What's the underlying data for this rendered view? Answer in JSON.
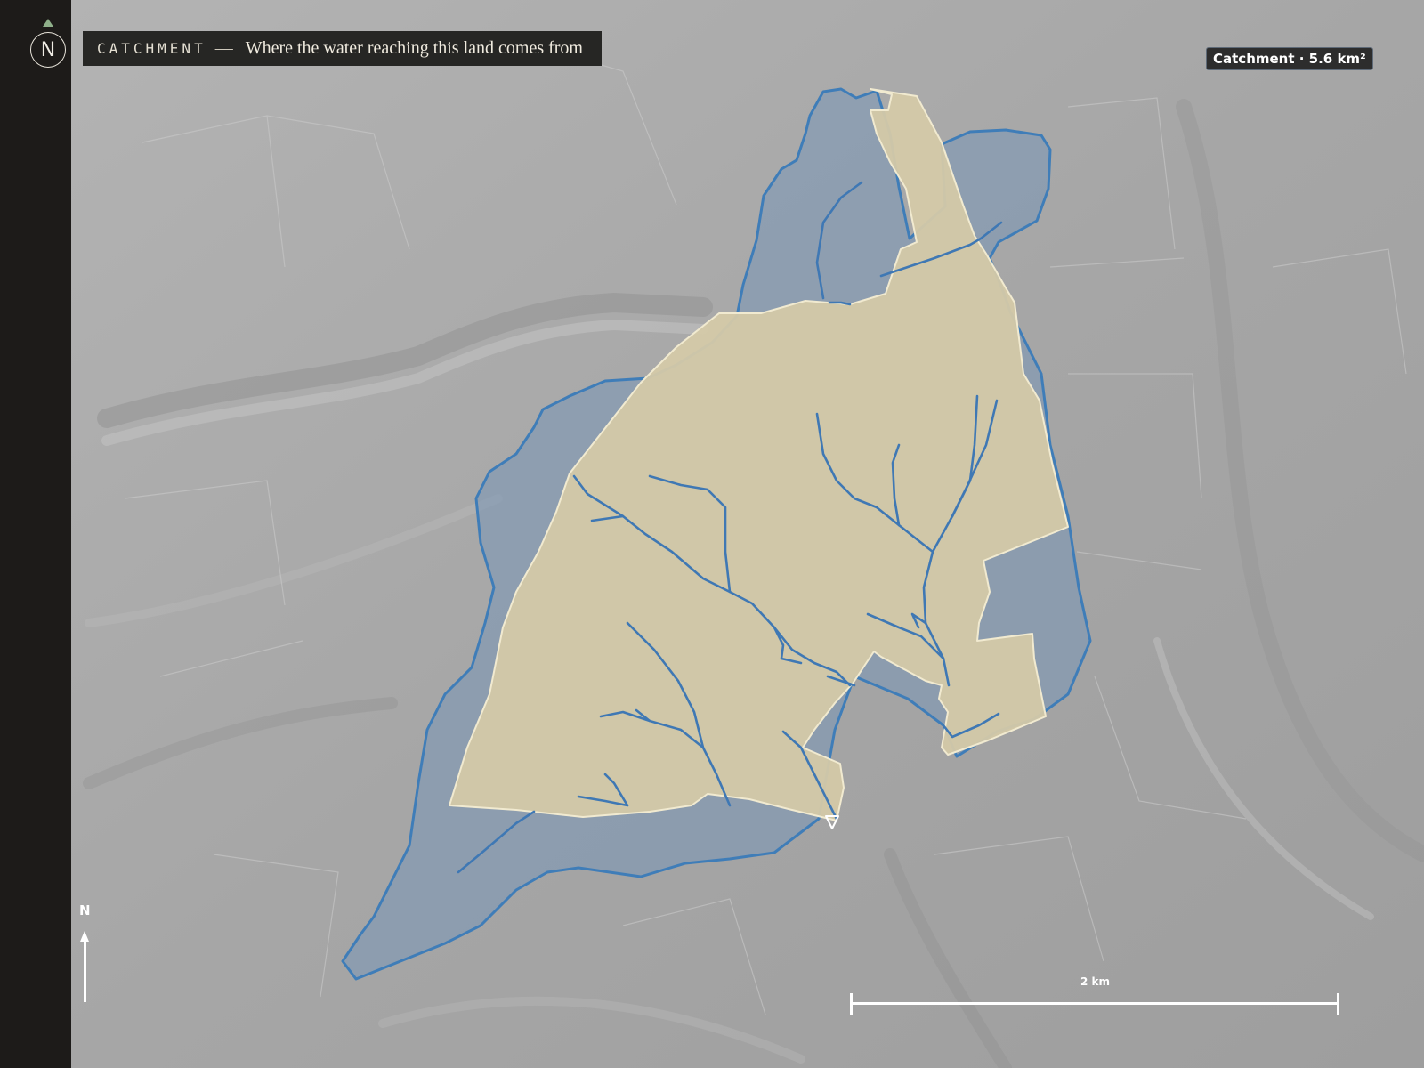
{
  "header": {
    "title_caps": "CATCHMENT",
    "separator": "—",
    "subtitle": "Where the water reaching this land comes from"
  },
  "badge": {
    "area_label": "Catchment · 5.6 km²"
  },
  "compass": {
    "letter": "N"
  },
  "north_arrow": {
    "label": "N"
  },
  "scale_bar": {
    "label": "2 km"
  },
  "colors": {
    "sidebar": "#1d1b19",
    "terrain": "#a9a9a9",
    "catchment_fill": "#7e98b4",
    "catchment_stroke": "#3f7db8",
    "land_fill": "#d4c9a8",
    "land_stroke": "#f1ead0",
    "stream": "#3f78b4"
  },
  "icons": {
    "compass": "compass-north-icon",
    "north_arrow": "north-arrow-icon",
    "outlet": "outlet-triangle-icon"
  }
}
